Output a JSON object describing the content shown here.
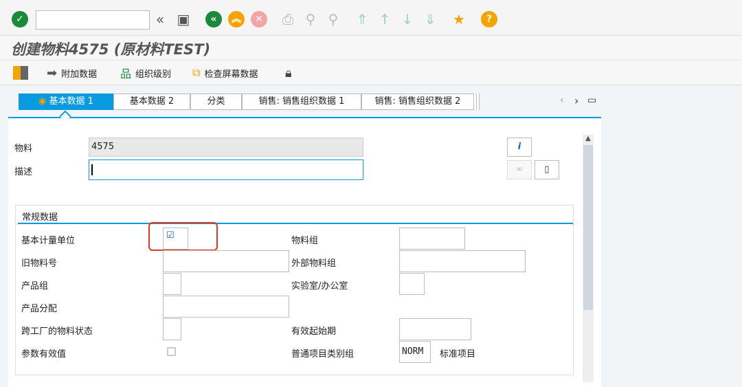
{
  "system_toolbar": {
    "command_field": "",
    "icons": [
      "enter-icon",
      "collapse-icon",
      "save-icon",
      "back-icon",
      "exit-icon",
      "cancel-icon",
      "print-icon",
      "find-icon",
      "find-next-icon",
      "first-page-icon",
      "previous-page-icon",
      "next-page-icon",
      "last-page-icon",
      "new-session-icon",
      "help-icon"
    ]
  },
  "title": "创建物料4575 (原材料TEST)",
  "app_toolbar": {
    "additional_data": "附加数据",
    "org_levels": "组织级别",
    "check_screen_data": "检查屏幕数据"
  },
  "tabs": [
    {
      "label": "基本数据 1",
      "active": true
    },
    {
      "label": "基本数据 2"
    },
    {
      "label": "分类"
    },
    {
      "label": "销售: 销售组织数据 1"
    },
    {
      "label": "销售: 销售组织数据 2"
    }
  ],
  "header": {
    "material_label": "物料",
    "material_value": "4575",
    "description_label": "描述",
    "description_value": ""
  },
  "general": {
    "title": "常规数据",
    "base_uom": "基本计量单位",
    "old_material": "旧物料号",
    "division": "产品组",
    "product_alloc": "产品分配",
    "xplant_status": "跨工厂的物料状态",
    "param_eff": "参数有效值",
    "material_group": "物料组",
    "ext_material_group": "外部物料组",
    "lab_office": "实验室/办公室",
    "valid_from": "有效起始期",
    "gen_item_cat": "普通项目类别组",
    "gen_item_cat_value": "NORM",
    "gen_item_cat_desc": "标准项目"
  },
  "colors": {
    "accent": "#0a9ae0",
    "highlight": "#e8341c"
  }
}
